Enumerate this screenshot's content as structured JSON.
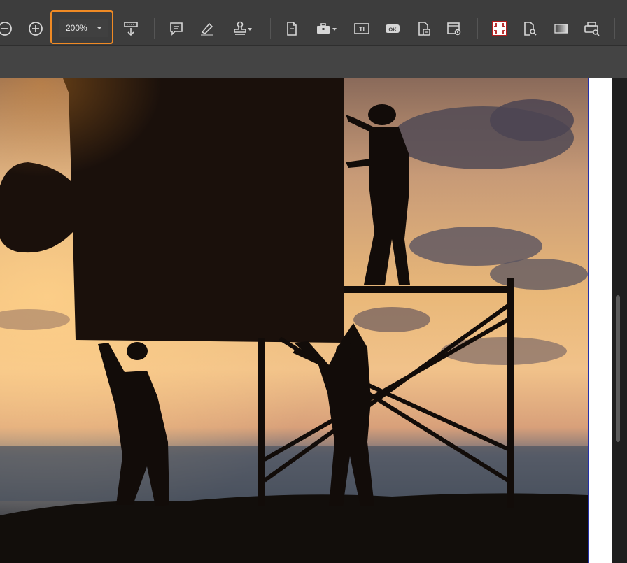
{
  "toolbar": {
    "zoom_value": "200%",
    "buttons": [
      {
        "name": "zoom-out",
        "icon": "minus-circle-icon"
      },
      {
        "name": "zoom-in",
        "icon": "plus-circle-icon"
      },
      {
        "name": "page-layout",
        "icon": "page-down-icon"
      },
      {
        "name": "comment",
        "icon": "comment-icon"
      },
      {
        "name": "highlight",
        "icon": "highlighter-icon"
      },
      {
        "name": "stamp",
        "icon": "stamp-icon"
      },
      {
        "name": "document",
        "icon": "document-icon"
      },
      {
        "name": "tools",
        "icon": "briefcase-icon"
      },
      {
        "name": "text-field",
        "icon": "text-field-icon"
      },
      {
        "name": "ok-button-field",
        "icon": "ok-icon"
      },
      {
        "name": "document-edit",
        "icon": "document-edit-icon"
      },
      {
        "name": "document-settings",
        "icon": "document-settings-icon"
      },
      {
        "name": "crop",
        "icon": "crop-icon"
      },
      {
        "name": "document-search",
        "icon": "document-search-icon"
      },
      {
        "name": "gradient",
        "icon": "gradient-icon"
      },
      {
        "name": "print-preview",
        "icon": "print-search-icon"
      }
    ],
    "ok_text": "OK",
    "textfield_text": "TI"
  },
  "colors": {
    "accent_highlight": "#f08a24",
    "guide_line": "#37c837",
    "page_edge": "#2430a8"
  }
}
